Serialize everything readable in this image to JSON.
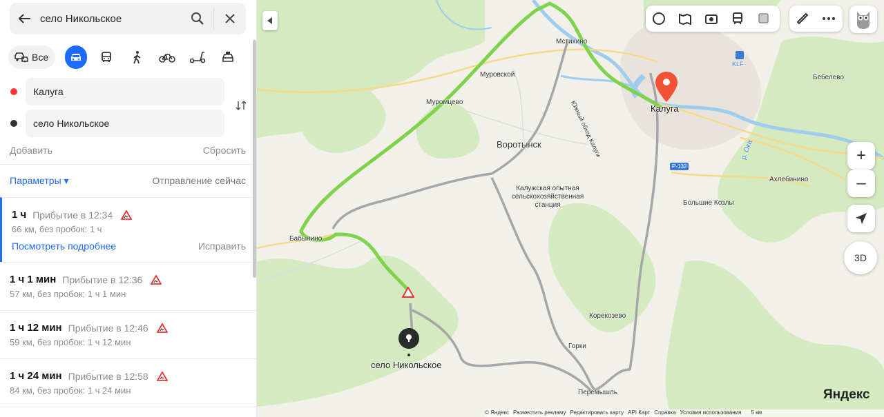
{
  "search": {
    "query": "село Никольское"
  },
  "modes": {
    "all_label": "Все"
  },
  "waypoints": [
    {
      "label": "Калуга",
      "color": "#ff3333"
    },
    {
      "label": "село Никольское",
      "color": "#333333"
    }
  ],
  "actions": {
    "add": "Добавить",
    "reset": "Сбросить"
  },
  "params": {
    "label": "Параметры ▾",
    "departure": "Отправление сейчас"
  },
  "routes": [
    {
      "duration": "1 ч",
      "arrival": "Прибытие в 12:34",
      "info": "66 км, без пробок: 1 ч",
      "details": "Посмотреть подробнее",
      "fix": "Исправить"
    },
    {
      "duration": "1 ч 1 мин",
      "arrival": "Прибытие в 12:36",
      "info": "57 км, без пробок: 1 ч 1 мин"
    },
    {
      "duration": "1 ч 12 мин",
      "arrival": "Прибытие в 12:46",
      "info": "59 км, без пробок: 1 ч 12 мин"
    },
    {
      "duration": "1 ч 24 мин",
      "arrival": "Прибытие в 12:58",
      "info": "84 км, без пробок: 1 ч 24 мин"
    }
  ],
  "map": {
    "places": {
      "moshkhino": "Мстихино",
      "murovskoy": "Муровской",
      "muromtsevo": "Муромцево",
      "vorotynsk": "Воротынск",
      "station": "Калужская опытная сельскохозяйственная станция",
      "babynino": "Бабынино",
      "kaluga": "Калуга",
      "klf": "KLF",
      "bebelevo": "Бебелево",
      "akhlebinino": "Ахлебинино",
      "bolshie_kozly": "Большие Козлы",
      "koreozevo": "Корекозево",
      "gorki": "Горки",
      "peremyshl": "Перемышль",
      "oka": "р. Ока",
      "bypass": "Южный обход Калуги",
      "r132": "Р-132",
      "dest": "село Никольское"
    },
    "controls": {
      "three_d": "3D",
      "zoom_in": "+",
      "zoom_out": "–"
    },
    "logo": "Яндекс",
    "footer": [
      "© Яндекс",
      "Разместить рекламу",
      "Редактировать карту",
      "API Карт",
      "Справка",
      "Условия использования",
      "5 км"
    ],
    "colors": {
      "route_main": "#7fd34a",
      "route_alt": "#a6a6a6",
      "water": "#a8d4f5",
      "forest": "#cde8b8"
    }
  }
}
